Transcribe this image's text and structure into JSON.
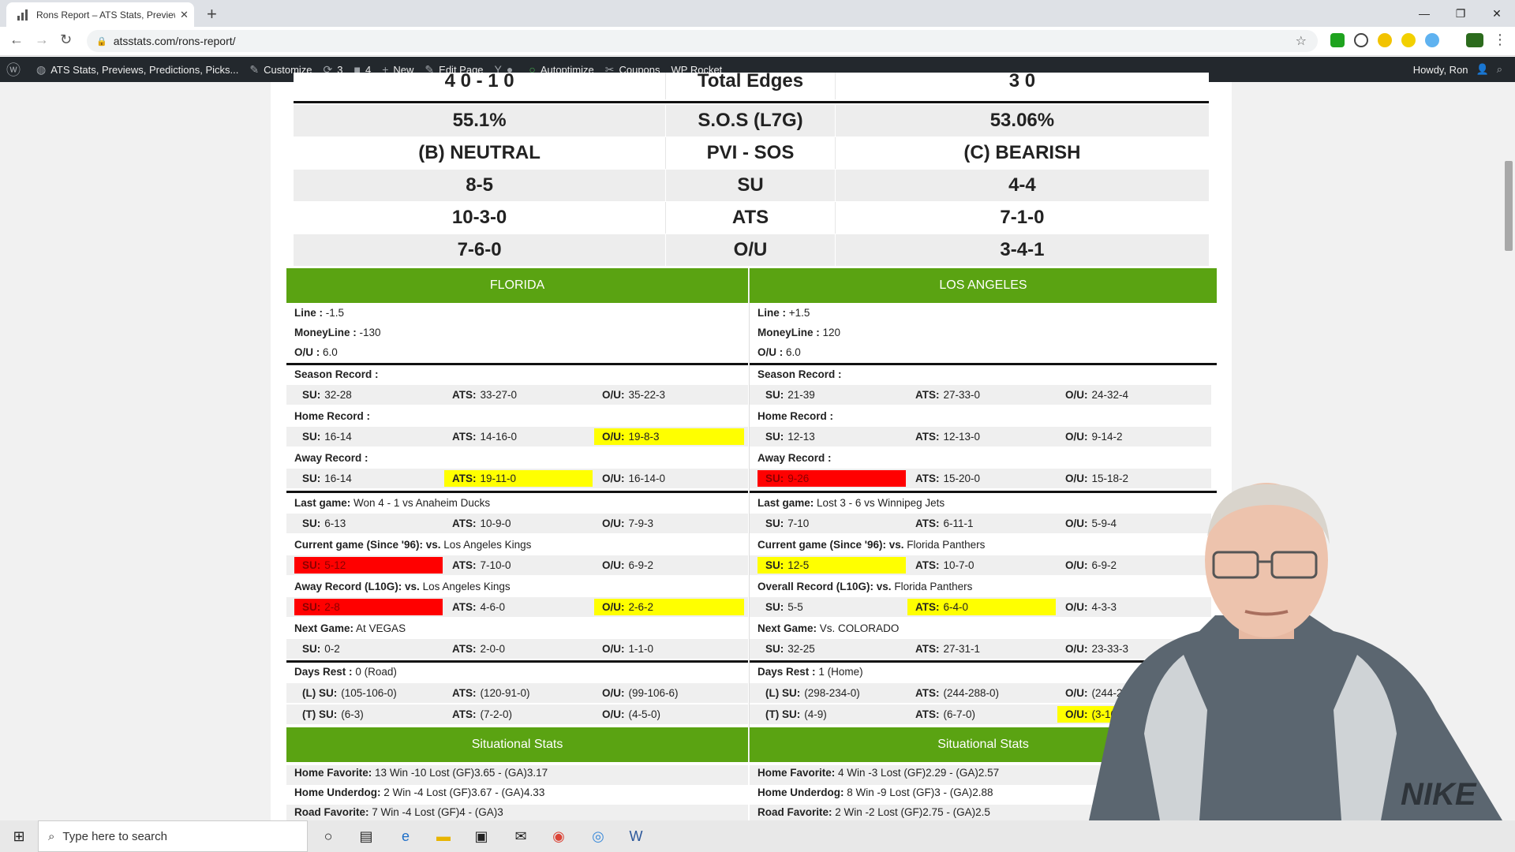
{
  "browser": {
    "tab_title": "Rons Report – ATS Stats, Preview",
    "url": "atsstats.com/rons-report/"
  },
  "wp_admin": {
    "site_name": "ATS Stats, Previews, Predictions, Picks...",
    "customize": "Customize",
    "updates": "3",
    "comments": "4",
    "new": "New",
    "edit_page": "Edit Page",
    "autoptimize": "Autoptimize",
    "coupons": "Coupons",
    "wp_rocket": "WP Rocket",
    "howdy": "Howdy, Ron"
  },
  "summary": [
    {
      "left": "4 0 - 1 0",
      "mid": "Total Edges",
      "right": "3 0"
    },
    {
      "left": "55.1%",
      "mid": "S.O.S (L7G)",
      "right": "53.06%"
    },
    {
      "left": "(B) NEUTRAL",
      "mid": "PVI - SOS",
      "right": "(C) BEARISH"
    },
    {
      "left": "8-5",
      "mid": "SU",
      "right": "4-4"
    },
    {
      "left": "10-3-0",
      "mid": "ATS",
      "right": "7-1-0"
    },
    {
      "left": "7-6-0",
      "mid": "O/U",
      "right": "3-4-1"
    }
  ],
  "teams": [
    {
      "name": "FLORIDA",
      "line_label": "Line :",
      "line": "-1.5",
      "ml_label": "MoneyLine :",
      "ml": "-130",
      "ou_label": "O/U :",
      "ou": "6.0",
      "season_label": "Season Record :",
      "season": {
        "su": "32-28",
        "ats": "33-27-0",
        "ou": "35-22-3"
      },
      "home_label": "Home Record :",
      "home": {
        "su": "16-14",
        "ats": "14-16-0",
        "ou": "19-8-3"
      },
      "away_label": "Away Record :",
      "away": {
        "su": "16-14",
        "ats": "19-11-0",
        "ou": "16-14-0"
      },
      "last_label": "Last game:",
      "last": "Won 4 - 1 vs Anaheim Ducks",
      "last_rec": {
        "su": "6-13",
        "ats": "10-9-0",
        "ou": "7-9-3"
      },
      "current_label": "Current game (Since '96): vs.",
      "current_opp": "Los Angeles Kings",
      "current_rec": {
        "su": "5-12",
        "ats": "7-10-0",
        "ou": "6-9-2"
      },
      "l10_label": "Away Record (L10G): vs.",
      "l10_opp": "Los Angeles Kings",
      "l10_rec": {
        "su": "2-8",
        "ats": "4-6-0",
        "ou": "2-6-2"
      },
      "next_label": "Next Game:",
      "next": "At VEGAS",
      "next_rec": {
        "su": "0-2",
        "ats": "2-0-0",
        "ou": "1-1-0"
      },
      "rest_label": "Days Rest :",
      "rest": "0 (Road)",
      "rest_l": {
        "su": "(105-106-0)",
        "ats": "(120-91-0)",
        "ou": "(99-106-6)"
      },
      "rest_t": {
        "su": "(6-3)",
        "ats": "(7-2-0)",
        "ou": "(4-5-0)"
      },
      "situational_title": "Situational Stats",
      "situational": [
        {
          "label": "Home Favorite:",
          "text": "13 Win -10 Lost   (GF)3.65 - (GA)3.17"
        },
        {
          "label": "Home Underdog:",
          "text": "2 Win -4 Lost   (GF)3.67 - (GA)4.33"
        },
        {
          "label": "Road Favorite:",
          "text": "7 Win -4 Lost   (GF)4 - (GA)3"
        }
      ]
    },
    {
      "name": "LOS ANGELES",
      "line_label": "Line :",
      "line": "+1.5",
      "ml_label": "MoneyLine :",
      "ml": "120",
      "ou_label": "O/U :",
      "ou": "6.0",
      "season_label": "Season Record :",
      "season": {
        "su": "21-39",
        "ats": "27-33-0",
        "ou": "24-32-4"
      },
      "home_label": "Home Record :",
      "home": {
        "su": "12-13",
        "ats": "12-13-0",
        "ou": "9-14-2"
      },
      "away_label": "Away Record :",
      "away": {
        "su": "9-26",
        "ats": "15-20-0",
        "ou": "15-18-2"
      },
      "last_label": "Last game:",
      "last": "Lost 3 - 6 vs Winnipeg Jets",
      "last_rec": {
        "su": "7-10",
        "ats": "6-11-1",
        "ou": "5-9-4"
      },
      "current_label": "Current game (Since '96): vs.",
      "current_opp": "Florida Panthers",
      "current_rec": {
        "su": "12-5",
        "ats": "10-7-0",
        "ou": "6-9-2"
      },
      "l10_label": "Overall Record (L10G): vs.",
      "l10_opp": "Florida Panthers",
      "l10_rec": {
        "su": "5-5",
        "ats": "6-4-0",
        "ou": "4-3-3"
      },
      "next_label": "Next Game:",
      "next": "Vs. COLORADO",
      "next_rec": {
        "su": "32-25",
        "ats": "27-31-1",
        "ou": "23-33-3"
      },
      "rest_label": "Days Rest :",
      "rest": "1 (Home)",
      "rest_l": {
        "su": "(298-234-0)",
        "ats": "(244-288-0)",
        "ou": "(244-266-22)"
      },
      "rest_t": {
        "su": "(4-9)",
        "ats": "(6-7-0)",
        "ou": "(3-10-0)"
      },
      "situational_title": "Situational Stats",
      "situational": [
        {
          "label": "Home Favorite:",
          "text": "4 Win -3 Lost   (GF)2.29 - (GA)2.57"
        },
        {
          "label": "Home Underdog:",
          "text": "8 Win -9 Lost   (GF)3 - (GA)2.88"
        },
        {
          "label": "Road Favorite:",
          "text": "2 Win -2 Lost   (GF)2.75 - (GA)2.5"
        }
      ]
    }
  ],
  "labels": {
    "su": "SU:",
    "ats": "ATS:",
    "ou": "O/U:",
    "lsu": "(L) SU:",
    "tsu": "(T) SU:"
  },
  "taskbar": {
    "search_placeholder": "Type here to search"
  },
  "colors": {
    "green": "#5aa312",
    "highlight_yellow": "#ffff00",
    "highlight_red": "#ff0000"
  }
}
